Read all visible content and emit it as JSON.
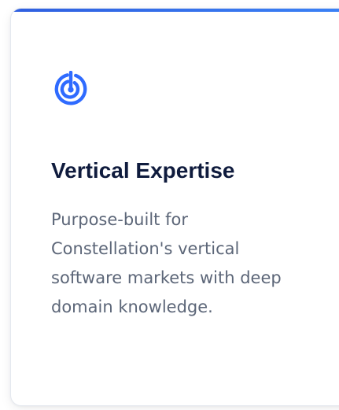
{
  "card": {
    "icon": "radar-target-icon",
    "accent_color": "#2f6bff",
    "title": "Vertical Expertise",
    "description": "Purpose-built for Constellation's vertical software markets with deep domain knowledge."
  }
}
